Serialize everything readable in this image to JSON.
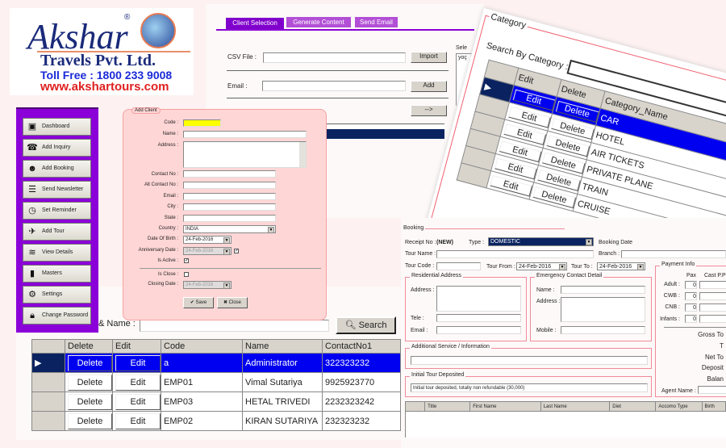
{
  "logo": {
    "line1": "Akshar",
    "reg": "®",
    "line2": "Travels Pvt. Ltd.",
    "tollfree": "Toll Free : 1800 233 9008",
    "website": "www.akshartours.com"
  },
  "colors": {
    "purple": "#8b00d8",
    "tab": "#b24fd6",
    "tab_active": "#8000cc",
    "selection": "#0000f0",
    "nav_dark": "#0a2360",
    "pink_dialog": "#ffd6d6",
    "code_highlight": "#ffff00"
  },
  "newsletter": {
    "tabs": [
      {
        "label": "Client Selection",
        "active": true
      },
      {
        "label": "Generate Content"
      },
      {
        "label": "Send Email"
      }
    ],
    "csv_label": "CSV File :",
    "csv_value": "",
    "import_label": "Import",
    "email_label": "Email :",
    "email_value": "",
    "add_label": "Add",
    "arrow_label": "-->",
    "selected_label": "Sele",
    "selected_item": "yoç"
  },
  "add_client": {
    "title": "Add Client",
    "fields": {
      "code": "Code :",
      "name": "Name :",
      "address": "Address :",
      "contact": "Contact No :",
      "alt_contact": "Alt Contact No :",
      "email": "Email :",
      "city": "City :",
      "state": "State :",
      "country": "Country :",
      "dob": "Date Of Birth :",
      "anniversary": "Anniversary Date :",
      "is_active": "Is Active :",
      "is_close": "Is Close :",
      "closing_date": "Closing Date :"
    },
    "country_value": "INDIA",
    "dob_value": "24-Feb-2016",
    "anniversary_value": "24-Feb-2016",
    "closing_value": "24-Feb-2016",
    "is_active": true,
    "anniversary_checked": true,
    "is_close": false,
    "save_label": "Save",
    "close_label": "Close"
  },
  "sidebar": {
    "items": [
      {
        "label": "Dashboard",
        "icon": "dashboard-icon"
      },
      {
        "label": "Add Inquiry",
        "icon": "phone-icon"
      },
      {
        "label": "Add Booking",
        "icon": "person-icon"
      },
      {
        "label": "Send Newsletter",
        "icon": "document-icon"
      },
      {
        "label": "Set Reminder",
        "icon": "clock-icon"
      },
      {
        "label": "Add Tour",
        "icon": "airplane-icon"
      },
      {
        "label": "View Details",
        "icon": "layers-icon"
      },
      {
        "label": "Masters",
        "icon": "book-icon"
      },
      {
        "label": "Settings",
        "icon": "gear-icon"
      },
      {
        "label": "Change Password",
        "icon": "lock-icon"
      }
    ]
  },
  "employees": {
    "search_label": "& Name :",
    "search_value": "",
    "search_button": "Search",
    "columns": [
      "Delete",
      "Edit",
      "Code",
      "Name",
      "ContactNo1"
    ],
    "rows": [
      {
        "delete": "Delete",
        "edit": "Edit",
        "code": "a",
        "name": "Administrator",
        "contact": "322323232",
        "selected": true
      },
      {
        "delete": "Delete",
        "edit": "Edit",
        "code": "EMP01",
        "name": "Vimal Sutariya",
        "contact": "9925923770"
      },
      {
        "delete": "Delete",
        "edit": "Edit",
        "code": "EMP03",
        "name": "HETAL TRIVEDI",
        "contact": "2232323242"
      },
      {
        "delete": "Delete",
        "edit": "Edit",
        "code": "EMP02",
        "name": "KIRAN SUTARIYA",
        "contact": "232323232"
      }
    ]
  },
  "category": {
    "title": "Category",
    "search_label": "Search By Category :",
    "search_value": "",
    "columns": [
      "Edit",
      "Delete",
      "Category_Name"
    ],
    "rows": [
      {
        "edit": "Edit",
        "delete": "Delete",
        "name": "CAR",
        "selected": true
      },
      {
        "edit": "Edit",
        "delete": "Delete",
        "name": "HOTEL"
      },
      {
        "edit": "Edit",
        "delete": "Delete",
        "name": "AIR TICKETS"
      },
      {
        "edit": "Edit",
        "delete": "Delete",
        "name": "PRIVATE PLANE"
      },
      {
        "edit": "Edit",
        "delete": "Delete",
        "name": "TRAIN"
      },
      {
        "edit": "Edit",
        "delete": "Delete",
        "name": "CRUISE"
      }
    ]
  },
  "booking": {
    "title": "Booking",
    "receipt_label": "Receipt No :",
    "receipt_value": "(NEW)",
    "type_label": "Type :",
    "type_value": "DOMESTIC",
    "booking_date_label": "Booking Date",
    "tour_name_label": "Tour Name :",
    "branch_label": "Branch :",
    "tour_code_label": "Tour Code :",
    "tour_from_label": "Tour From :",
    "tour_from_value": "24-Feb-2016",
    "tour_to_label": "Tour To :",
    "tour_to_value": "24-Feb-2016",
    "residential": {
      "title": "Residential Address",
      "address": "Address :",
      "tele": "Tele :",
      "email": "Email :"
    },
    "emergency": {
      "title": "Emergency Contact Detail",
      "name": "Name :",
      "address": "Address :",
      "mobile": "Mobile :"
    },
    "additional": {
      "title": "Additional  Service / Information",
      "value": ""
    },
    "deposit": {
      "title": "Initial Tour Deposited",
      "value": "Initial tour deposited, totally non refundable (30,000)"
    },
    "payment": {
      "title": "Payment Info",
      "pax": "Pax",
      "cost": "Cast P.P",
      "rows": [
        {
          "label": "Adult :",
          "pax": "0"
        },
        {
          "label": "CWB :",
          "pax": "0"
        },
        {
          "label": "CNB :",
          "pax": "0"
        },
        {
          "label": "Infants :",
          "pax": "0"
        }
      ],
      "gross": "Gross To",
      "t": "T",
      "net": "Net To",
      "deposit": "Deposit",
      "balance": "Balan",
      "agent": "Agent Name :"
    },
    "passenger_columns": [
      "Title",
      "First Name",
      "Last Name",
      "Diet",
      "Accomo Type",
      "Birth"
    ]
  }
}
